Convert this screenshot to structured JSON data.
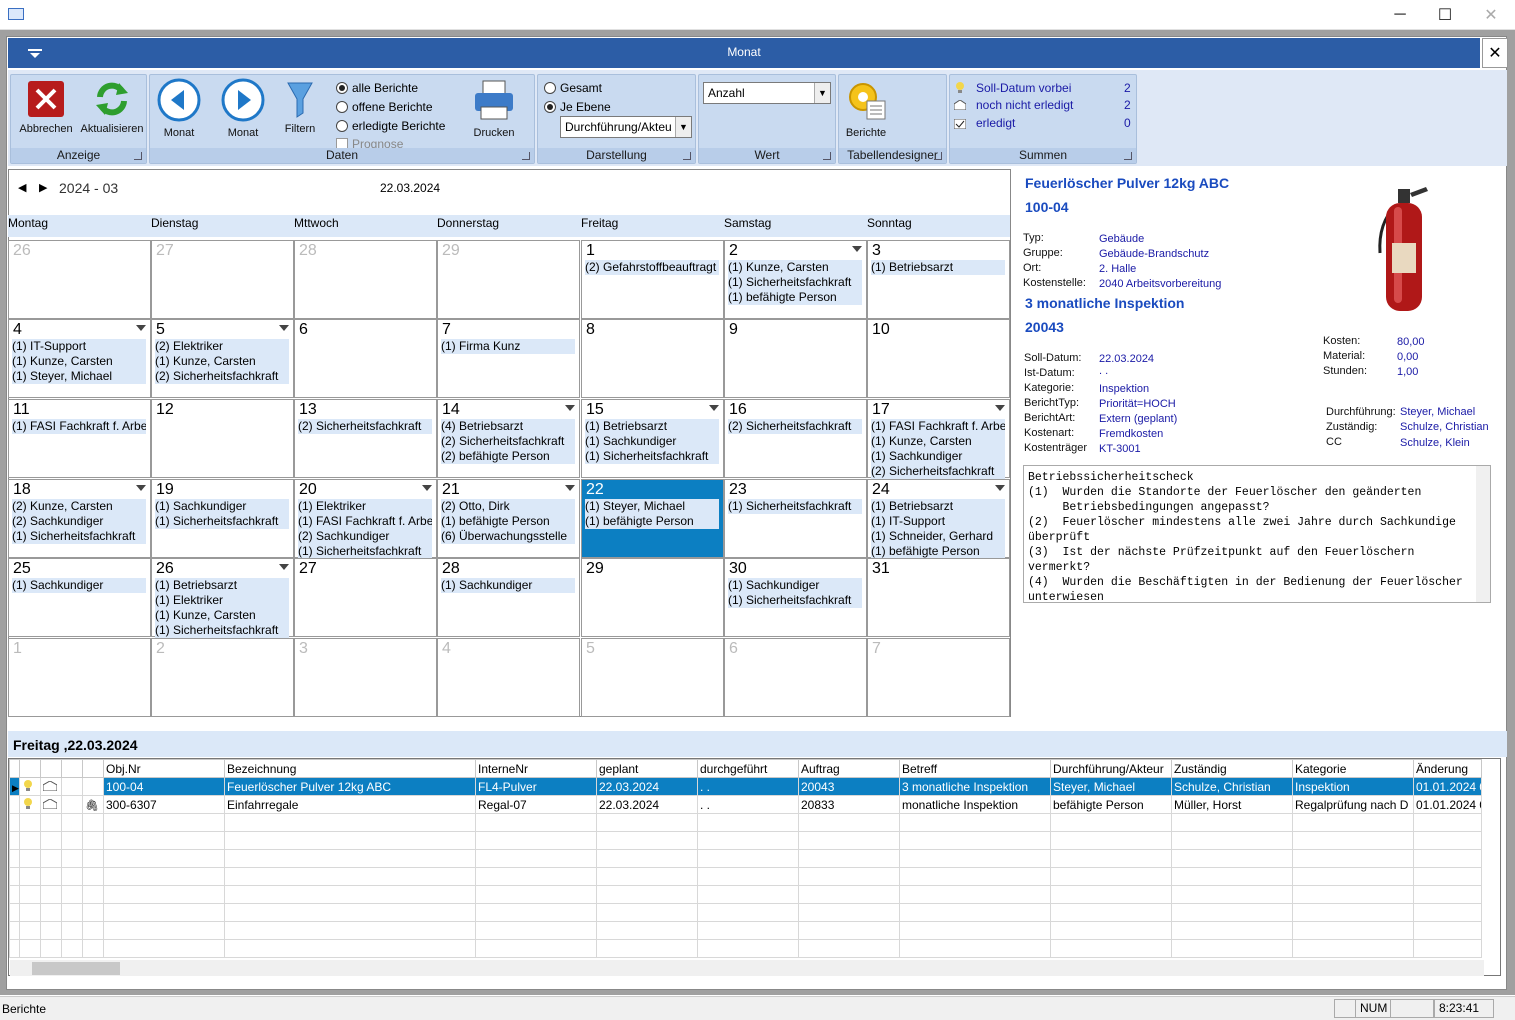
{
  "window": {
    "minimize": "─",
    "maximize": "☐",
    "close": "✕"
  },
  "mdi": {
    "title": "Monat",
    "close": "✕"
  },
  "ribbon": {
    "anzeige": {
      "label": "Anzeige",
      "cancel": "Abbrechen",
      "refresh": "Aktualisieren"
    },
    "daten": {
      "label": "Daten",
      "prev": "Monat",
      "next": "Monat",
      "filter": "Filtern",
      "r1": "alle Berichte",
      "r2": "offene Berichte",
      "r3": "erledigte Berichte",
      "prognose": "Prognose",
      "print": "Drucken"
    },
    "darstellung": {
      "label": "Darstellung",
      "r1": "Gesamt",
      "r2": "Je Ebene",
      "combo": "Durchführung/Akteu"
    },
    "wert": {
      "label": "Wert",
      "combo": "Anzahl"
    },
    "tabellendesigner": {
      "label": "Tabellendesigner",
      "btn": "Berichte"
    },
    "summen": {
      "label": "Summen",
      "rows": [
        {
          "label": "Soll-Datum vorbei",
          "value": "2"
        },
        {
          "label": "noch nicht erledigt",
          "value": "2"
        },
        {
          "label": "erledigt",
          "value": "0"
        }
      ]
    }
  },
  "calendar": {
    "month": "2024 - 03",
    "date": "22.03.2024",
    "days": [
      "Montag",
      "Dienstag",
      "Mttwoch",
      "Donnerstag",
      "Freitag",
      "Samstag",
      "Sonntag"
    ],
    "weeks": [
      [
        {
          "n": "26",
          "dim": true,
          "ev": []
        },
        {
          "n": "27",
          "dim": true,
          "ev": []
        },
        {
          "n": "28",
          "dim": true,
          "ev": []
        },
        {
          "n": "29",
          "dim": true,
          "ev": []
        },
        {
          "n": "1",
          "ev": [
            "(2) Gefahrstoffbeauftragt"
          ]
        },
        {
          "n": "2",
          "drop": true,
          "ev": [
            "(1) Kunze, Carsten",
            "(1) Sicherheitsfachkraft",
            "(1) befähigte Person"
          ]
        },
        {
          "n": "3",
          "ev": [
            "(1) Betriebsarzt"
          ]
        }
      ],
      [
        {
          "n": "4",
          "drop": true,
          "ev": [
            "(1) IT-Support",
            "(1) Kunze, Carsten",
            "(1) Steyer, Michael"
          ]
        },
        {
          "n": "5",
          "drop": true,
          "ev": [
            "(2) Elektriker",
            "(1) Kunze, Carsten",
            "(2) Sicherheitsfachkraft"
          ]
        },
        {
          "n": "6",
          "ev": []
        },
        {
          "n": "7",
          "ev": [
            "(1) Firma Kunz"
          ]
        },
        {
          "n": "8",
          "ev": []
        },
        {
          "n": "9",
          "ev": []
        },
        {
          "n": "10",
          "ev": []
        }
      ],
      [
        {
          "n": "11",
          "ev": [
            "(1) FASI Fachkraft f. Arbei"
          ]
        },
        {
          "n": "12",
          "ev": []
        },
        {
          "n": "13",
          "ev": [
            "(2) Sicherheitsfachkraft"
          ]
        },
        {
          "n": "14",
          "drop": true,
          "ev": [
            "(4) Betriebsarzt",
            "(2) Sicherheitsfachkraft",
            "(2) befähigte Person"
          ]
        },
        {
          "n": "15",
          "drop": true,
          "ev": [
            "(1) Betriebsarzt",
            "(1) Sachkundiger",
            "(1) Sicherheitsfachkraft"
          ]
        },
        {
          "n": "16",
          "ev": [
            "(2) Sicherheitsfachkraft"
          ]
        },
        {
          "n": "17",
          "drop": true,
          "ev": [
            "(1) FASI Fachkraft f. Arbei",
            "(1) Kunze, Carsten",
            "(1) Sachkundiger",
            "(2) Sicherheitsfachkraft"
          ]
        }
      ],
      [
        {
          "n": "18",
          "drop": true,
          "ev": [
            "(2) Kunze, Carsten",
            "(2) Sachkundiger",
            "(1) Sicherheitsfachkraft"
          ]
        },
        {
          "n": "19",
          "ev": [
            "(1) Sachkundiger",
            "(1) Sicherheitsfachkraft"
          ]
        },
        {
          "n": "20",
          "drop": true,
          "ev": [
            "(1) Elektriker",
            "(1) FASI Fachkraft f. Arbei",
            "(2) Sachkundiger",
            "(1) Sicherheitsfachkraft"
          ]
        },
        {
          "n": "21",
          "drop": true,
          "ev": [
            "(2) Otto, Dirk",
            "(1) befähigte Person",
            "(6) Überwachungsstelle"
          ]
        },
        {
          "n": "22",
          "sel": true,
          "ev": [
            "(1) Steyer, Michael",
            "(1) befähigte Person"
          ]
        },
        {
          "n": "23",
          "ev": [
            "(1) Sicherheitsfachkraft"
          ]
        },
        {
          "n": "24",
          "drop": true,
          "ev": [
            "(1) Betriebsarzt",
            "(1) IT-Support",
            "(1) Schneider, Gerhard",
            "(1) befähigte Person"
          ]
        }
      ],
      [
        {
          "n": "25",
          "ev": [
            "(1) Sachkundiger"
          ]
        },
        {
          "n": "26",
          "drop": true,
          "ev": [
            "(1) Betriebsarzt",
            "(1) Elektriker",
            "(1) Kunze, Carsten",
            "(1) Sicherheitsfachkraft"
          ]
        },
        {
          "n": "27",
          "ev": []
        },
        {
          "n": "28",
          "ev": [
            "(1) Sachkundiger"
          ]
        },
        {
          "n": "29",
          "ev": []
        },
        {
          "n": "30",
          "ev": [
            "(1) Sachkundiger",
            "(1) Sicherheitsfachkraft"
          ]
        },
        {
          "n": "31",
          "ev": []
        }
      ],
      [
        {
          "n": "1",
          "dim": true,
          "ev": []
        },
        {
          "n": "2",
          "dim": true,
          "ev": []
        },
        {
          "n": "3",
          "dim": true,
          "ev": []
        },
        {
          "n": "4",
          "dim": true,
          "ev": []
        },
        {
          "n": "5",
          "dim": true,
          "ev": []
        },
        {
          "n": "6",
          "dim": true,
          "ev": []
        },
        {
          "n": "7",
          "dim": true,
          "ev": []
        }
      ]
    ]
  },
  "detail": {
    "title": "Feuerlöscher Pulver 12kg ABC",
    "objnr": "100-04",
    "typ_k": "Typ:",
    "typ": "Gebäude",
    "gruppe_k": "Gruppe:",
    "gruppe": "Gebäude-Brandschutz",
    "ort_k": "Ort:",
    "ort": "2. Halle",
    "kst_k": "Kostenstelle:",
    "kst": "2040 Arbeitsvorbereitung",
    "inspektion": "3 monatliche Inspektion",
    "auftrag": "20043",
    "kosten_k": "Kosten:",
    "kosten": "80,00",
    "material_k": "Material:",
    "material": "0,00",
    "stunden_k": "Stunden:",
    "stunden": "1,00",
    "soll_k": "Soll-Datum:",
    "soll": "22.03.2024",
    "ist_k": "Ist-Datum:",
    "ist": ". .",
    "kat_k": "Kategorie:",
    "kat": "Inspektion",
    "btyp_k": "BerichtTyp:",
    "btyp": "Priorität=HOCH",
    "bart_k": "BerichtArt:",
    "bart": "Extern (geplant)",
    "kart_k": "Kostenart:",
    "kart": "Fremdkosten",
    "ktr_k": "Kostenträger",
    "ktr": "KT-3001",
    "durch_k": "Durchführung:",
    "durch": "Steyer, Michael",
    "zust_k": "Zuständig:",
    "zust": "Schulze, Christian",
    "cc_k": "CC",
    "cc": "Schulze, Klein",
    "notes": "Betriebssicherheitscheck\n(1)  Wurden die Standorte der Feuerlöscher den geänderten\n     Betriebsbedingungen angepasst?\n(2)  Feuerlöscher mindestens alle zwei Jahre durch Sachkundige\nüberprüft\n(3)  Ist der nächste Prüfzeitpunkt auf den Feuerlöschern\nvermerkt?\n(4)  Wurden die Beschäftigten in der Bedienung der Feuerlöscher\nunterwiesen"
  },
  "daystrip": "Freitag ,22.03.2024",
  "table": {
    "headers": [
      "Obj.Nr",
      "Bezeichnung",
      "InterneNr",
      "geplant",
      "durchgeführt",
      "Auftrag",
      "Betreff",
      "Durchführung/Akteur",
      "Zuständig",
      "Kategorie",
      "Änderung"
    ],
    "rows": [
      [
        "100-04",
        "Feuerlöscher Pulver 12kg ABC",
        "FL4-Pulver",
        "22.03.2024",
        ". .",
        "20043",
        "3 monatliche Inspektion",
        "Steyer, Michael",
        "Schulze, Christian",
        "Inspektion",
        "01.01.2024 0"
      ],
      [
        "300-6307",
        "Einfahrregale",
        "Regal-07",
        "22.03.2024",
        ". .",
        "20833",
        "monatliche Inspektion",
        "befähigte Person",
        "Müller, Horst",
        "Regalprüfung nach D",
        "01.01.2024 0"
      ]
    ]
  },
  "status": {
    "left": "Berichte",
    "num": "NUM",
    "time": "8:23:41"
  }
}
